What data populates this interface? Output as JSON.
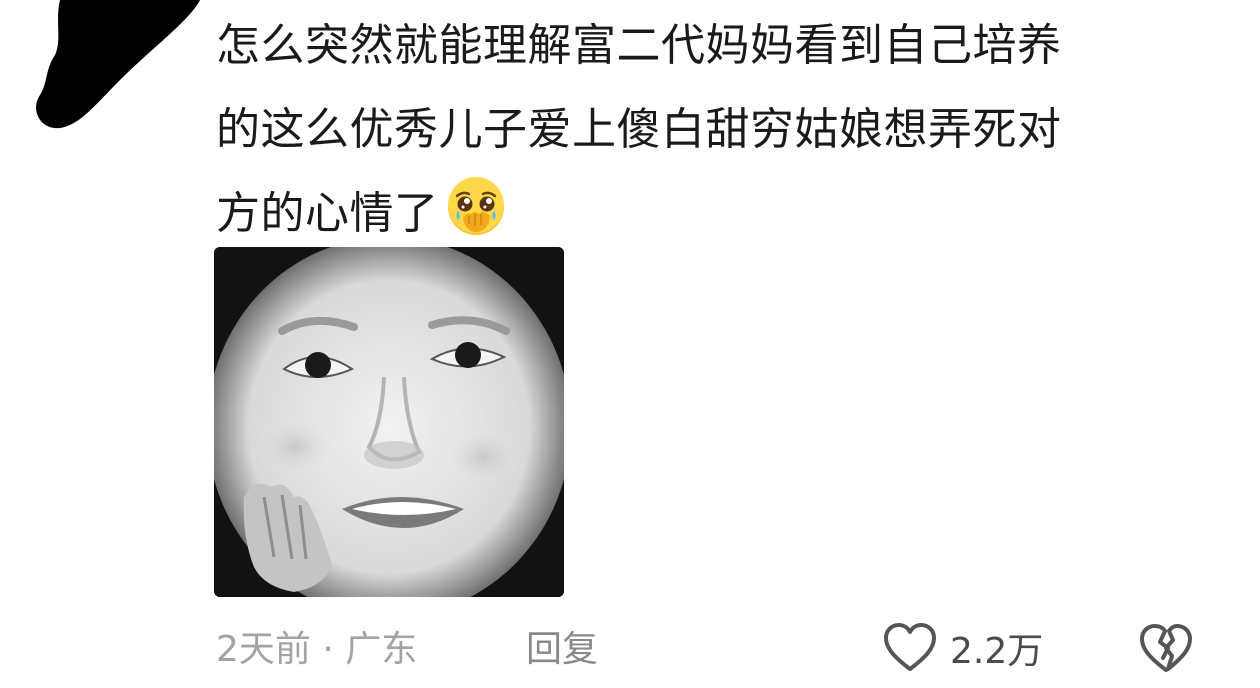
{
  "comment": {
    "lines": [
      "怎么突然就能理解富二代妈妈看到自己培养",
      "的这么优秀儿子爱上傻白甜穷姑娘想弄死对",
      "方的心情了"
    ],
    "emoji": "pleading-face-hands-over-mouth-icon"
  },
  "sticker": {
    "description_icon": "smiling-face-sticker-icon"
  },
  "meta": {
    "time_location": "2天前 · 广东",
    "reply_label": "回复"
  },
  "actions": {
    "like_count": "2.2万",
    "like_icon": "heart-outline-icon",
    "dislike_icon": "broken-heart-icon"
  },
  "colors": {
    "text": "#1a1a1a",
    "meta": "#a3a3a3",
    "icon": "#555555"
  }
}
